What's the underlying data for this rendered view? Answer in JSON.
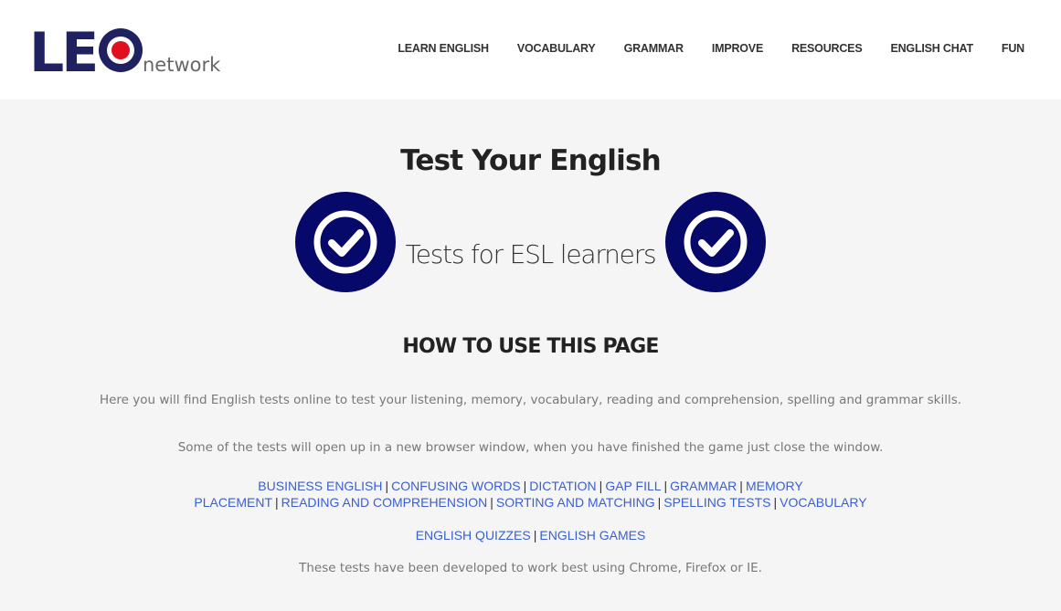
{
  "header": {
    "logo_text": "LEO",
    "logo_sub": "network",
    "nav": [
      "LEARN ENGLISH",
      "VOCABULARY",
      "GRAMMAR",
      "IMPROVE",
      "RESOURCES",
      "ENGLISH CHAT",
      "FUN"
    ]
  },
  "main": {
    "title": "Test Your English",
    "subtitle": "Tests for ESL learners",
    "howto_heading": "HOW TO USE THIS PAGE",
    "intro": "Here you will find English tests online to test your listening, memory, vocabulary, reading and comprehension, spelling and grammar skills.",
    "note": "Some of the tests will open up in a new browser window, when you have finished the game just close the window.",
    "links_row1": [
      "BUSINESS ENGLISH",
      "CONFUSING WORDS",
      "DICTATION",
      "GAP FILL",
      "GRAMMAR",
      "MEMORY"
    ],
    "links_row2": [
      "PLACEMENT",
      "READING AND COMPREHENSION",
      "SORTING AND MATCHING",
      "SPELLING TESTS",
      "VOCABULARY"
    ],
    "links_row3": [
      "ENGLISH QUIZZES",
      "ENGLISH GAMES"
    ],
    "separator": "|",
    "footer_note": "These tests have been developed to work best using Chrome, Firefox or IE."
  },
  "colors": {
    "brand_navy": "#1f2161",
    "badge_navy": "#06086a",
    "logo_red": "#e0101e",
    "link_blue": "#3a5fd0",
    "background": "#f5f5f5"
  },
  "icons": [
    "checkmark-circle-icon"
  ]
}
